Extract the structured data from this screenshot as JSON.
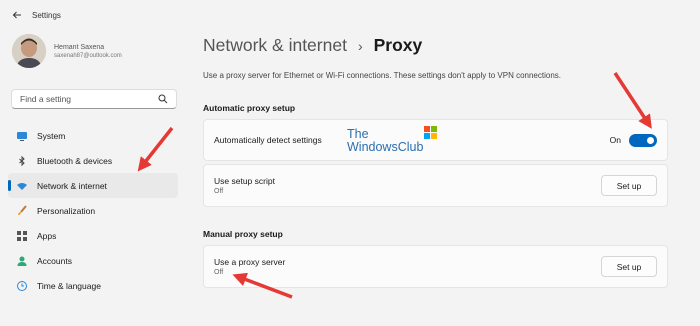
{
  "window": {
    "title": "Settings"
  },
  "profile": {
    "name": "Hemant Saxena",
    "email": "saxenah87@outlook.com"
  },
  "search": {
    "placeholder": "Find a setting"
  },
  "nav": {
    "items": [
      {
        "label": "System",
        "icon": "monitor-icon"
      },
      {
        "label": "Bluetooth & devices",
        "icon": "bluetooth-icon"
      },
      {
        "label": "Network & internet",
        "icon": "wifi-icon",
        "active": true
      },
      {
        "label": "Personalization",
        "icon": "paintbrush-icon"
      },
      {
        "label": "Apps",
        "icon": "apps-grid-icon"
      },
      {
        "label": "Accounts",
        "icon": "person-icon"
      },
      {
        "label": "Time & language",
        "icon": "globe-clock-icon"
      }
    ]
  },
  "breadcrumb": {
    "parent": "Network & internet",
    "separator": "›",
    "current": "Proxy"
  },
  "description": "Use a proxy server for Ethernet or Wi-Fi connections. These settings don't apply to VPN connections.",
  "automatic": {
    "title": "Automatic proxy setup",
    "detect": {
      "label": "Automatically detect settings",
      "state": "On"
    },
    "script": {
      "label": "Use setup script",
      "status": "Off",
      "button": "Set up"
    }
  },
  "manual": {
    "title": "Manual proxy setup",
    "server": {
      "label": "Use a proxy server",
      "status": "Off",
      "button": "Set up"
    }
  },
  "watermark": {
    "line1": "The",
    "line2": "WindowsClub"
  },
  "colors": {
    "accent": "#0067c0",
    "arrow": "#e53935",
    "background": "#f3f3f3",
    "card": "#fbfbfb"
  }
}
